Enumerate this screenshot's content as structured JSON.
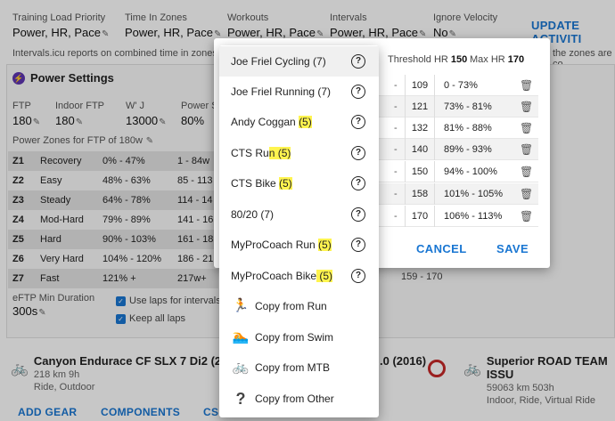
{
  "top": {
    "fields": [
      {
        "label": "Training Load Priority",
        "value": "Power, HR, Pace"
      },
      {
        "label": "Time In Zones",
        "value": "Power, HR, Pace"
      },
      {
        "label": "Workouts",
        "value": "Power, HR, Pace"
      },
      {
        "label": "Intervals",
        "value": "Power, HR, Pace"
      },
      {
        "label": "Ignore Velocity",
        "value": "No"
      }
    ],
    "update_button": "UPDATE ACTIVITI",
    "note_left": "Intervals.icu reports on combined time in zones.",
    "note_right": "the zones are co"
  },
  "power": {
    "title": "Power Settings",
    "fields": [
      {
        "label": "FTP",
        "value": "180"
      },
      {
        "label": "Indoor FTP",
        "value": "180"
      },
      {
        "label": "W' J",
        "value": "13000"
      },
      {
        "label": "Power S",
        "value": "80%"
      }
    ],
    "zones_title": "Power Zones for FTP of 180w",
    "zones": [
      {
        "id": "Z1",
        "name": "Recovery",
        "pct": "0% - 47%",
        "watts": "1 - 84w"
      },
      {
        "id": "Z2",
        "name": "Easy",
        "pct": "48% - 63%",
        "watts": "85 - 113"
      },
      {
        "id": "Z3",
        "name": "Steady",
        "pct": "64% - 78%",
        "watts": "114 - 14"
      },
      {
        "id": "Z4",
        "name": "Mod-Hard",
        "pct": "79% - 89%",
        "watts": "141 - 16"
      },
      {
        "id": "Z5",
        "name": "Hard",
        "pct": "90% - 103%",
        "watts": "161 - 18"
      },
      {
        "id": "Z6",
        "name": "Very Hard",
        "pct": "104% - 120%",
        "watts": "186 - 21"
      },
      {
        "id": "Z7",
        "name": "Fast",
        "pct": "121% +",
        "watts": "217w+"
      }
    ],
    "eftp_label": "eFTP Min Duration",
    "eftp_value": "300s",
    "use_laps": "Use laps for intervals",
    "keep_laps": "Keep all laps"
  },
  "gear": [
    {
      "name": "Canyon Endurace CF SLX 7 Di2 (2024)",
      "stats": "218 km   9h",
      "type": "Ride, Outdoor"
    },
    {
      "name": ".0 (2016)",
      "stats": "",
      "type": ""
    },
    {
      "name": "Superior ROAD TEAM ISSU",
      "stats": "59063 km   503h",
      "type": "Indoor, Ride, Virtual Ride"
    }
  ],
  "bottom_links": [
    "ADD GEAR",
    "COMPONENTS",
    "CS"
  ],
  "dialog": {
    "threshold_hr_label": "Threshold HR",
    "threshold_hr": "150",
    "max_hr_label": "Max HR",
    "max_hr": "170",
    "rows": [
      {
        "left": "",
        "high": "109",
        "pct": "0 - 73%"
      },
      {
        "left": "0",
        "high": "121",
        "pct": "73% - 81%"
      },
      {
        "left": "2",
        "high": "132",
        "pct": "81% - 88%"
      },
      {
        "left": "3",
        "high": "140",
        "pct": "89% - 93%"
      },
      {
        "left": "",
        "high": "150",
        "pct": "94% - 100%"
      },
      {
        "left": "",
        "high": "158",
        "pct": "101% - 105%"
      },
      {
        "left": "0",
        "high": "170",
        "pct": "106% - 113%"
      }
    ],
    "cancel": "CANCEL",
    "save": "SAVE",
    "behind_range": "159 - 170"
  },
  "menu": {
    "presets": [
      {
        "pre": "Joe Friel Cycling (7)",
        "hl": "",
        "post": ""
      },
      {
        "pre": "Joe Friel Running (7)",
        "hl": "",
        "post": ""
      },
      {
        "pre": "Andy Coggan ",
        "hl": "(5)",
        "post": ""
      },
      {
        "pre": "CTS Ru",
        "hl": "n (5)",
        "post": ""
      },
      {
        "pre": "CTS Bike ",
        "hl": "(5)",
        "post": ""
      },
      {
        "pre": "80/20 (7)",
        "hl": "",
        "post": ""
      },
      {
        "pre": "MyProCoach Run ",
        "hl": "(5)",
        "post": ""
      },
      {
        "pre": "MyProCoach Bike",
        "hl": " (5)",
        "post": ""
      }
    ],
    "copy": [
      {
        "label": "Copy from Run",
        "icon": "running-icon"
      },
      {
        "label": "Copy from Swim",
        "icon": "swimming-icon"
      },
      {
        "label": "Copy from MTB",
        "icon": "bicycle-icon"
      },
      {
        "label": "Copy from Other",
        "icon": "question-mark-icon"
      }
    ]
  }
}
